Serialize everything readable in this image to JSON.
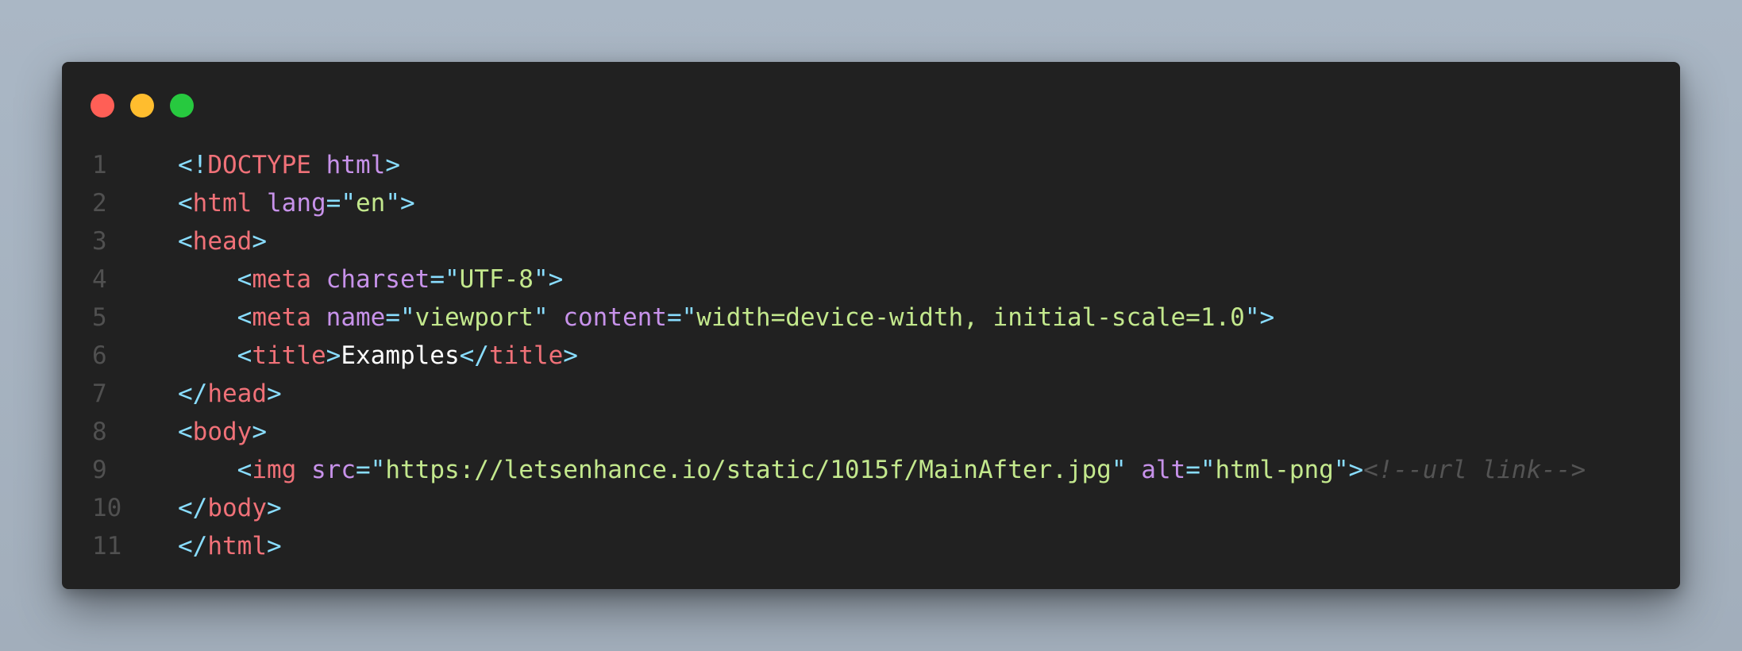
{
  "window": {
    "controls": [
      {
        "name": "close",
        "color": "#ff5f56"
      },
      {
        "name": "minimize",
        "color": "#ffbd2e"
      },
      {
        "name": "maximize",
        "color": "#27c93f"
      }
    ]
  },
  "code": {
    "lines": [
      {
        "number": "1",
        "tokens": [
          {
            "type": "p",
            "text": "<!"
          },
          {
            "type": "t",
            "text": "DOCTYPE"
          },
          {
            "type": "w",
            "text": " "
          },
          {
            "type": "a",
            "text": "html"
          },
          {
            "type": "p",
            "text": ">"
          }
        ]
      },
      {
        "number": "2",
        "tokens": [
          {
            "type": "p",
            "text": "<"
          },
          {
            "type": "t",
            "text": "html"
          },
          {
            "type": "w",
            "text": " "
          },
          {
            "type": "a",
            "text": "lang"
          },
          {
            "type": "p",
            "text": "=\""
          },
          {
            "type": "s",
            "text": "en"
          },
          {
            "type": "p",
            "text": "\">"
          }
        ]
      },
      {
        "number": "3",
        "tokens": [
          {
            "type": "p",
            "text": "<"
          },
          {
            "type": "t",
            "text": "head"
          },
          {
            "type": "p",
            "text": ">"
          }
        ]
      },
      {
        "number": "4",
        "tokens": [
          {
            "type": "w",
            "text": "    "
          },
          {
            "type": "p",
            "text": "<"
          },
          {
            "type": "t",
            "text": "meta"
          },
          {
            "type": "w",
            "text": " "
          },
          {
            "type": "a",
            "text": "charset"
          },
          {
            "type": "p",
            "text": "=\""
          },
          {
            "type": "s",
            "text": "UTF-8"
          },
          {
            "type": "p",
            "text": "\">"
          }
        ]
      },
      {
        "number": "5",
        "tokens": [
          {
            "type": "w",
            "text": "    "
          },
          {
            "type": "p",
            "text": "<"
          },
          {
            "type": "t",
            "text": "meta"
          },
          {
            "type": "w",
            "text": " "
          },
          {
            "type": "a",
            "text": "name"
          },
          {
            "type": "p",
            "text": "=\""
          },
          {
            "type": "s",
            "text": "viewport"
          },
          {
            "type": "p",
            "text": "\""
          },
          {
            "type": "w",
            "text": " "
          },
          {
            "type": "a",
            "text": "content"
          },
          {
            "type": "p",
            "text": "=\""
          },
          {
            "type": "s",
            "text": "width=device-width, initial-scale=1.0"
          },
          {
            "type": "p",
            "text": "\">"
          }
        ]
      },
      {
        "number": "6",
        "tokens": [
          {
            "type": "w",
            "text": "    "
          },
          {
            "type": "p",
            "text": "<"
          },
          {
            "type": "t",
            "text": "title"
          },
          {
            "type": "p",
            "text": ">"
          },
          {
            "type": "x",
            "text": "Examples"
          },
          {
            "type": "p",
            "text": "</"
          },
          {
            "type": "t",
            "text": "title"
          },
          {
            "type": "p",
            "text": ">"
          }
        ]
      },
      {
        "number": "7",
        "tokens": [
          {
            "type": "p",
            "text": "</"
          },
          {
            "type": "t",
            "text": "head"
          },
          {
            "type": "p",
            "text": ">"
          }
        ]
      },
      {
        "number": "8",
        "tokens": [
          {
            "type": "p",
            "text": "<"
          },
          {
            "type": "t",
            "text": "body"
          },
          {
            "type": "p",
            "text": ">"
          }
        ]
      },
      {
        "number": "9",
        "tokens": [
          {
            "type": "w",
            "text": "    "
          },
          {
            "type": "p",
            "text": "<"
          },
          {
            "type": "t",
            "text": "img"
          },
          {
            "type": "w",
            "text": " "
          },
          {
            "type": "a",
            "text": "src"
          },
          {
            "type": "p",
            "text": "=\""
          },
          {
            "type": "s",
            "text": "https://letsenhance.io/static/1015f/MainAfter.jpg"
          },
          {
            "type": "p",
            "text": "\""
          },
          {
            "type": "w",
            "text": " "
          },
          {
            "type": "a",
            "text": "alt"
          },
          {
            "type": "p",
            "text": "=\""
          },
          {
            "type": "s",
            "text": "html-png"
          },
          {
            "type": "p",
            "text": "\">"
          },
          {
            "type": "c",
            "text": "<!--url link-->"
          }
        ]
      },
      {
        "number": "10",
        "tokens": [
          {
            "type": "p",
            "text": "</"
          },
          {
            "type": "t",
            "text": "body"
          },
          {
            "type": "p",
            "text": ">"
          }
        ]
      },
      {
        "number": "11",
        "tokens": [
          {
            "type": "p",
            "text": "</"
          },
          {
            "type": "t",
            "text": "html"
          },
          {
            "type": "p",
            "text": ">"
          }
        ]
      }
    ]
  }
}
